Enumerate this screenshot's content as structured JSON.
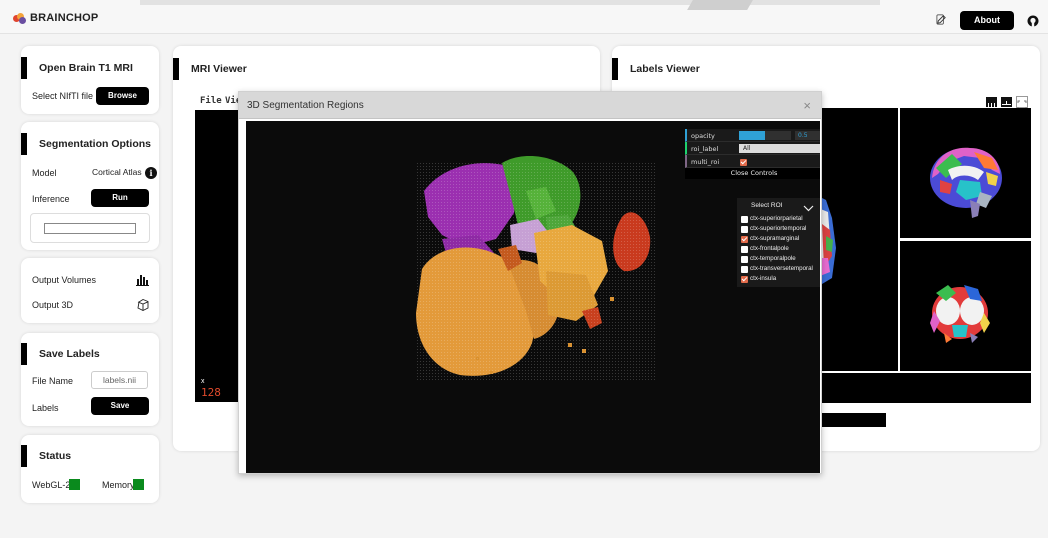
{
  "app": {
    "brand": "BRAINCHOP",
    "about_label": "About"
  },
  "open_mri": {
    "title": "Open Brain T1 MRI",
    "select_label": "Select NIfTI file",
    "browse_label": "Browse"
  },
  "segmentation": {
    "title": "Segmentation Options",
    "model_label": "Model",
    "model_value": "Cortical Atlas",
    "inference_label": "Inference",
    "run_label": "Run"
  },
  "output": {
    "volumes_label": "Output Volumes",
    "output3d_label": "Output 3D"
  },
  "save_labels": {
    "title": "Save Labels",
    "file_name_label": "File Name",
    "file_name_value": "labels.nii",
    "labels_label": "Labels",
    "save_label": "Save"
  },
  "status": {
    "title": "Status",
    "webgl_label": "WebGL-2",
    "memory_label": "Memory",
    "ok_color": "#0a8a1d"
  },
  "mri_viewer": {
    "title": "MRI Viewer",
    "menu_file": "File",
    "menu_view": "Vie",
    "coord_axis": "x",
    "coord_value": "128"
  },
  "labels_viewer": {
    "title": "Labels Viewer"
  },
  "modal": {
    "title": "3D Segmentation Regions",
    "close_glyph": "×",
    "controls": {
      "opacity_label": "opacity",
      "opacity_value": "0.5",
      "opacity_fraction": 0.5,
      "roi_label_label": "roi_label",
      "roi_label_value": "All",
      "multi_roi_label": "multi_roi",
      "multi_roi_checked": true,
      "close_label": "Close Controls"
    },
    "roi": {
      "header": "Select ROI",
      "items": [
        {
          "label": "ctx-superiorparietal",
          "checked": false
        },
        {
          "label": "ctx-superiortemporal",
          "checked": false
        },
        {
          "label": "ctx-supramarginal",
          "checked": true
        },
        {
          "label": "ctx-frontalpole",
          "checked": false
        },
        {
          "label": "ctx-temporalpole",
          "checked": false
        },
        {
          "label": "ctx-transversetemporal",
          "checked": false
        },
        {
          "label": "ctx-insula",
          "checked": true
        }
      ]
    }
  },
  "colors": {
    "accent": "#2fa1d6",
    "checkbox_on": "#e26b4b",
    "coord_text": "#e04a2c"
  }
}
